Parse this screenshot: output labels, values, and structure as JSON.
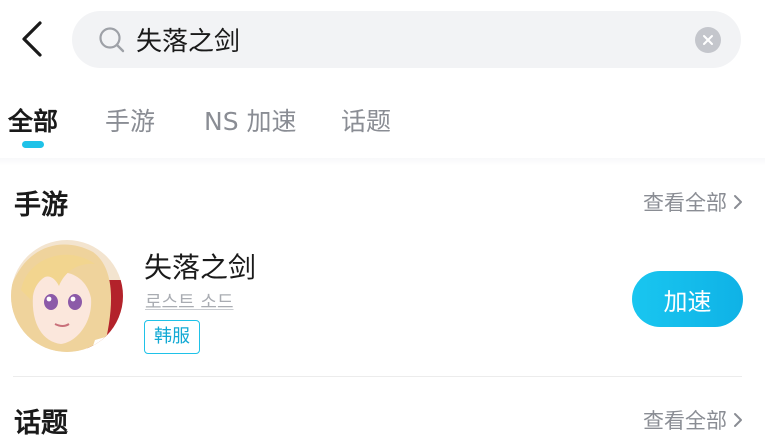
{
  "search": {
    "query": "失落之剑",
    "back_icon": "chevron-left-icon",
    "search_icon": "search-icon",
    "clear_icon": "close-circle-icon"
  },
  "tabs": [
    {
      "label": "全部",
      "active": true
    },
    {
      "label": "手游",
      "active": false
    },
    {
      "label": "NS 加速",
      "active": false
    },
    {
      "label": "话题",
      "active": false
    }
  ],
  "sections": {
    "mobile_games": {
      "title": "手游",
      "view_all": "查看全部"
    },
    "topics": {
      "title": "话题",
      "view_all": "查看全部"
    }
  },
  "game": {
    "name": "失落之剑",
    "subtitle": "로스트 소드",
    "region_badge": "韩服",
    "action_label": "加速"
  },
  "colors": {
    "accent": "#1fc2e8",
    "button": "#19c6f0",
    "muted_text": "#8a8d94",
    "search_bg": "#f2f3f5"
  }
}
